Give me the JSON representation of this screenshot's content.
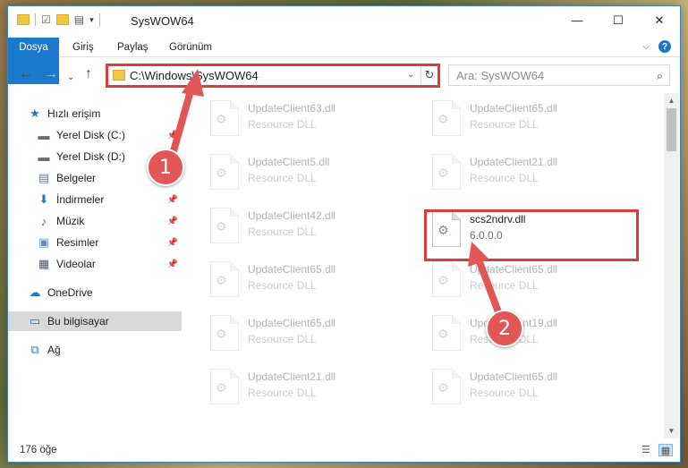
{
  "window": {
    "title": "SysWOW64",
    "controls": {
      "minimize": "—",
      "maximize": "☐",
      "close": "✕"
    }
  },
  "ribbon": {
    "tabs": [
      {
        "label": "Dosya"
      },
      {
        "label": "Giriş"
      },
      {
        "label": "Paylaş"
      },
      {
        "label": "Görünüm"
      }
    ],
    "help_label": "?"
  },
  "address": {
    "path": "C:\\Windows\\SysWOW64",
    "search_placeholder": "Ara: SysWOW64"
  },
  "sidebar": {
    "items": [
      {
        "label": "Hızlı erişim",
        "icon": "star-icon",
        "glyph": "★",
        "color": "#1979ca"
      },
      {
        "label": "Yerel Disk (C:)",
        "icon": "drive-icon",
        "glyph": "▬",
        "color": "#5a6f86",
        "pinned": true
      },
      {
        "label": "Yerel Disk (D:)",
        "icon": "drive-icon",
        "glyph": "▬",
        "color": "#5a6f86"
      },
      {
        "label": "Belgeler",
        "icon": "documents-icon",
        "glyph": "▤",
        "color": "#6d7a8a",
        "pinned": true
      },
      {
        "label": "İndirmeler",
        "icon": "download-icon",
        "glyph": "⬇",
        "color": "#1979ca",
        "pinned": true
      },
      {
        "label": "Müzik",
        "icon": "music-icon",
        "glyph": "♪",
        "color": "#1979ca",
        "pinned": true
      },
      {
        "label": "Resimler",
        "icon": "pictures-icon",
        "glyph": "▣",
        "color": "#5b8fc9",
        "pinned": true
      },
      {
        "label": "Videolar",
        "icon": "video-icon",
        "glyph": "▦",
        "color": "#4a5563",
        "pinned": true
      },
      {
        "label": "OneDrive",
        "icon": "cloud-icon",
        "glyph": "☁",
        "color": "#1979ca"
      },
      {
        "label": "Bu bilgisayar",
        "icon": "computer-icon",
        "glyph": "▭",
        "color": "#1979ca",
        "selected": true
      },
      {
        "label": "Ağ",
        "icon": "network-icon",
        "glyph": "⧉",
        "color": "#1979ca"
      }
    ]
  },
  "files": [
    {
      "name": "UpdateClient63.dll",
      "desc": "Resource DLL"
    },
    {
      "name": "UpdateClient65.dll",
      "desc": "Resource DLL"
    },
    {
      "name": "UpdateClient5.dll",
      "desc": "Resource DLL"
    },
    {
      "name": "UpdateClient21.dll",
      "desc": "Resource DLL"
    },
    {
      "name": "UpdateClient42.dll",
      "desc": "Resource DLL"
    },
    {
      "name": "scs2ndrv.dll",
      "desc": "6.0.0.0",
      "highlighted": true
    },
    {
      "name": "UpdateClient65.dll",
      "desc": "Resource DLL"
    },
    {
      "name": "UpdateClient65.dll",
      "desc": "Resource DLL"
    },
    {
      "name": "UpdateClient65.dll",
      "desc": "Resource DLL"
    },
    {
      "name": "UpdateClient19.dll",
      "desc": "Resource DLL"
    },
    {
      "name": "UpdateClient21.dll",
      "desc": "Resource DLL"
    },
    {
      "name": "UpdateClient65.dll",
      "desc": "Resource DLL"
    }
  ],
  "status": {
    "item_count": "176 öğe"
  },
  "annotations": {
    "callout_1": "1",
    "callout_2": "2",
    "highlight_color": "#e03b3b",
    "callout_color": "#e25656"
  }
}
